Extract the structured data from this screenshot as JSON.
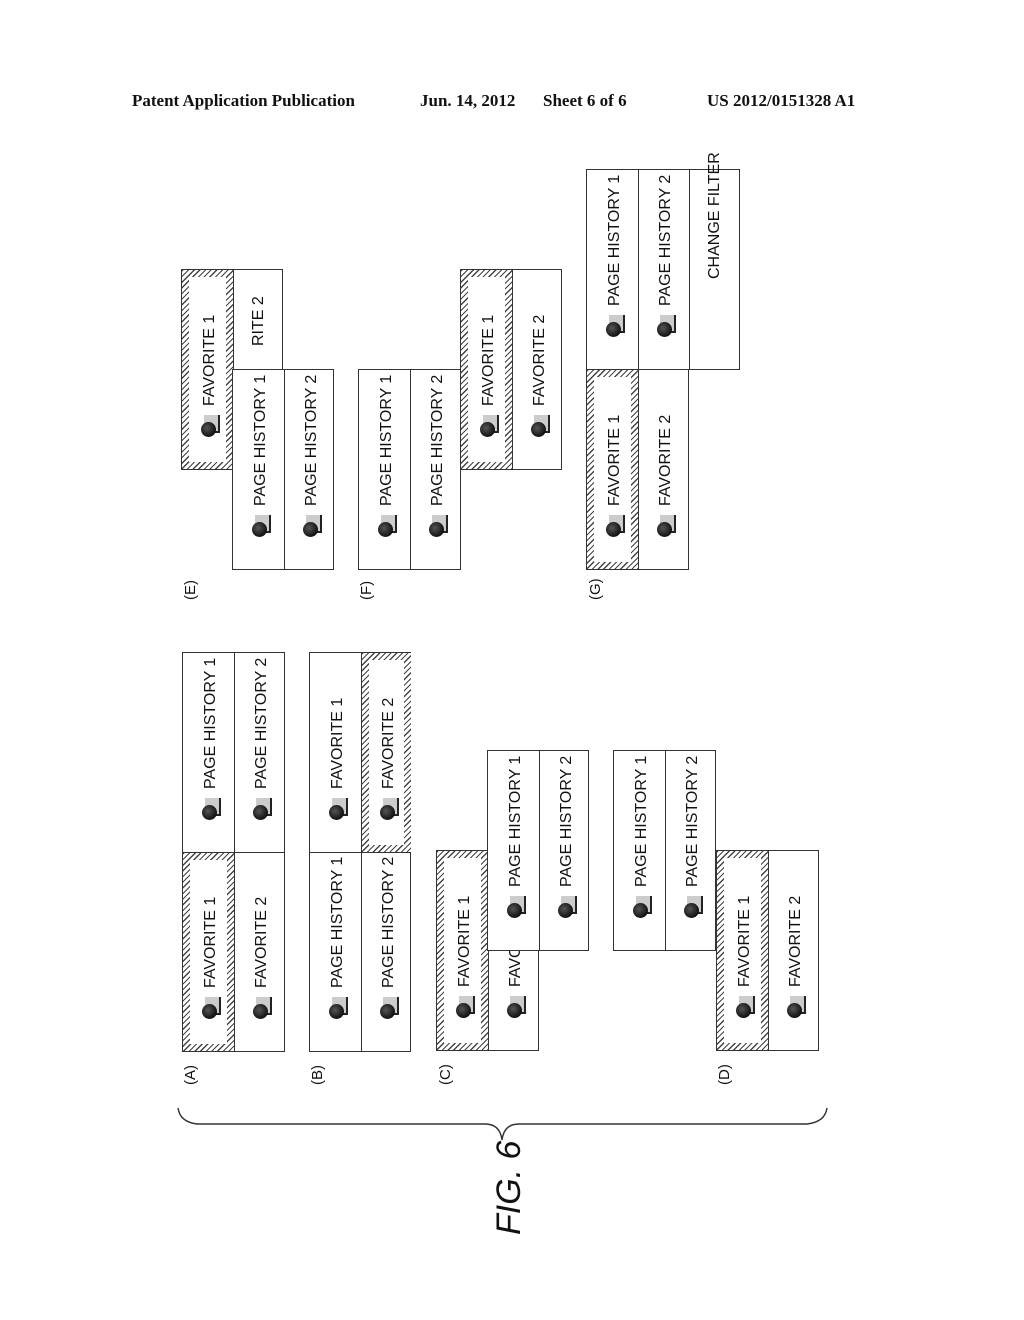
{
  "header": {
    "left": "Patent Application Publication",
    "date": "Jun. 14, 2012",
    "sheet": "Sheet 6 of 6",
    "number": "US 2012/0151328 A1"
  },
  "figure": {
    "title": "FIG. 6"
  },
  "items": {
    "favorite_1": "FAVORITE 1",
    "favorite_2": "FAVORITE 2",
    "favorite_partial_C": "FAVOR",
    "favorite_partial_E": "RITE 2",
    "page_history_1": "PAGE HISTORY 1",
    "page_history_2": "PAGE HISTORY 2",
    "change_filter": "CHANGE FILTER"
  },
  "panels": {
    "A": "(A)",
    "B": "(B)",
    "C": "(C)",
    "D": "(D)",
    "E": "(E)",
    "F": "(F)",
    "G": "(G)"
  },
  "states": {
    "A": {
      "selected": "FAVORITE 1"
    },
    "B": {
      "selected": "FAVORITE 2"
    },
    "C": {
      "selected": "FAVORITE 1"
    },
    "D": {
      "selected": "FAVORITE 1"
    },
    "E": {
      "selected": "FAVORITE 1"
    },
    "F": {
      "selected": "FAVORITE 1"
    },
    "G": {
      "selected": "FAVORITE 1"
    }
  }
}
